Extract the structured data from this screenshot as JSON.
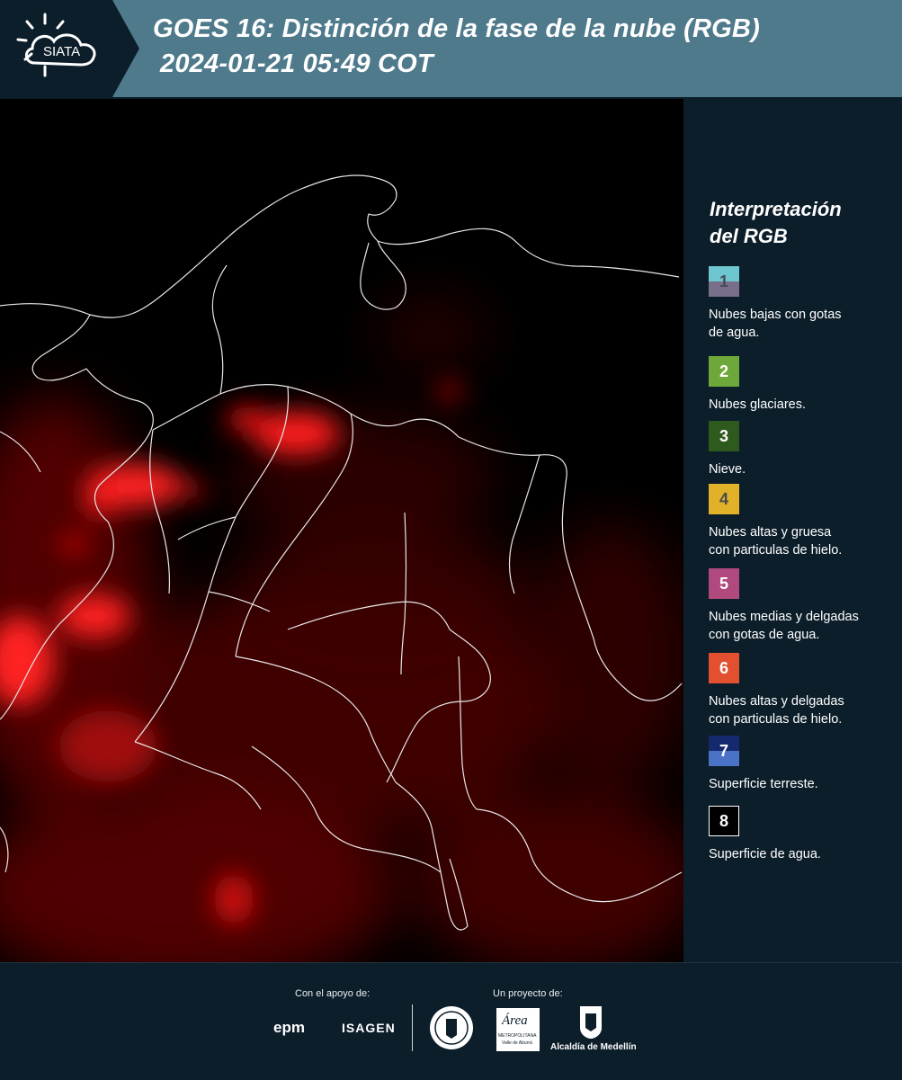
{
  "header": {
    "logo_text": "SIATA",
    "title_line1": "GOES 16: Distinción de la fase de la nube (RGB)",
    "title_line2": "2024-01-21 05:49 COT"
  },
  "legend": {
    "title_line1": "Interpretación",
    "title_line2": "del RGB",
    "items": [
      {
        "num": "1",
        "label_line1": "Nubes bajas con gotas",
        "label_line2": "de agua.",
        "color_top": "#6ec6d0",
        "color_bottom": "#7a6f8a",
        "num_color": "#4a4a5a"
      },
      {
        "num": "2",
        "label_line1": "Nubes glaciares.",
        "label_line2": "",
        "color_top": "#6fa83a",
        "color_bottom": "#6fa83a",
        "num_color": "#ffffff"
      },
      {
        "num": "3",
        "label_line1": "Nieve.",
        "label_line2": "",
        "color_top": "#2f5a1e",
        "color_bottom": "#2f5a1e",
        "num_color": "#ffffff"
      },
      {
        "num": "4",
        "label_line1": "Nubes altas y gruesa",
        "label_line2": "con particulas de hielo.",
        "color_top": "#e2b12a",
        "color_bottom": "#e2b12a",
        "num_color": "#4a4a4a"
      },
      {
        "num": "5",
        "label_line1": "Nubes medias y delgadas",
        "label_line2": "con gotas de agua.",
        "color_top": "#b04a7e",
        "color_bottom": "#b04a7e",
        "num_color": "#ffffff"
      },
      {
        "num": "6",
        "label_line1": "Nubes altas y delgadas",
        "label_line2": "con particulas de hielo.",
        "color_top": "#e2502f",
        "color_bottom": "#e2502f",
        "num_color": "#ffffff"
      },
      {
        "num": "7",
        "label_line1": "Superficie terreste.",
        "label_line2": "",
        "color_top": "#152a6e",
        "color_bottom": "#4a73c8",
        "num_color": "#ffffff"
      },
      {
        "num": "8",
        "label_line1": "Superficie de agua.",
        "label_line2": "",
        "color_top": "#000000",
        "color_bottom": "#000000",
        "num_color": "#ffffff"
      }
    ]
  },
  "footer": {
    "support_label": "Con el apoyo de:",
    "project_label": "Un proyecto de:",
    "sponsor_epm": "epm",
    "sponsor_isagen": "ISAGEN",
    "area_text": "Área",
    "area_sub1": "METROPOLITANA",
    "area_sub2": "Valle de Aburrá",
    "alcaldia": "Alcaldía de Medellín"
  },
  "colors": {
    "header_bg": "#4e7a8c",
    "panel_bg": "#0c1e2a",
    "cloud_red": "#ff1a1a"
  }
}
